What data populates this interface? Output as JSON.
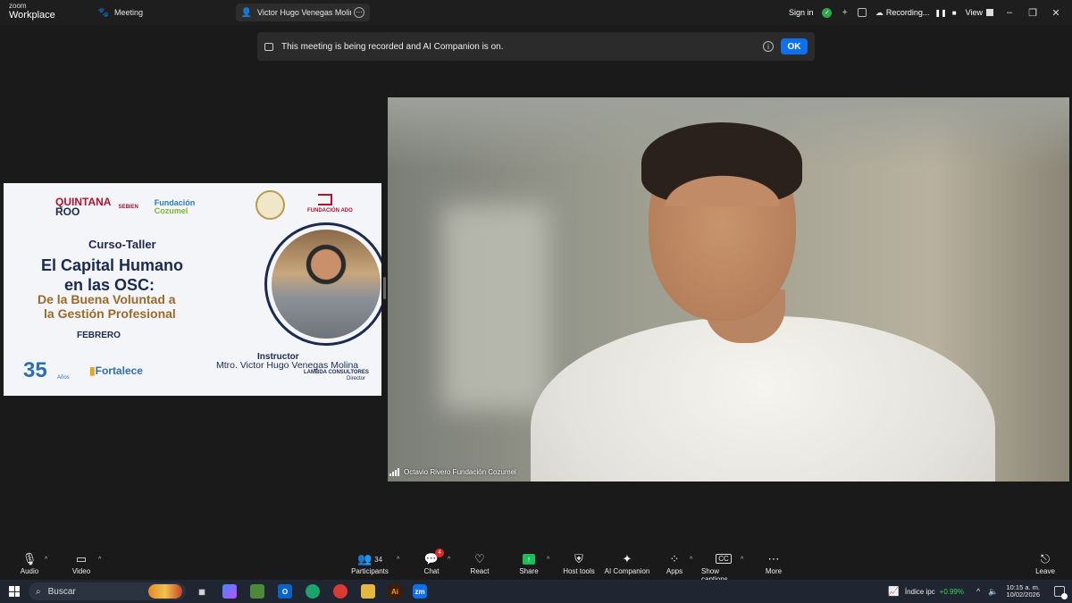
{
  "titlebar": {
    "brand_top": "zoom",
    "brand_bottom": "Workplace",
    "meeting_tab": "Meeting",
    "share_tab": "Victor Hugo Venegas Molina's scr",
    "share_tab_more": "⋯",
    "sign_in": "Sign in",
    "recording": "Recording...",
    "view": "View"
  },
  "banner": {
    "text": "This meeting is being recorded and AI Companion is on.",
    "ok_label": "OK"
  },
  "slide": {
    "logo_quintana": "QUINTANA",
    "logo_roo": "ROO",
    "logo_sebien": "SEBIEN",
    "logo_fundacion": "Fundación",
    "logo_cozumel": "Cozumel",
    "logo_ado": "FUNDACIÓN ADO",
    "course_type": "Curso-Taller",
    "title_line1": "El Capital Humano",
    "title_line2": "en las OSC:",
    "subtitle_line1": "De la Buena Voluntad a",
    "subtitle_line2": "la Gestión Profesional",
    "month": "FEBRERO",
    "instructor_label": "Instructor",
    "instructor_name": "Mtro. Victor Hugo Venegas Molina",
    "instructor_org": "LAMBDA CONSULTORES",
    "instructor_role": "Director",
    "anniversary": "35",
    "anniversary_years": "Años",
    "fortalece": "Fortalece"
  },
  "video": {
    "participant_name": "Octavio Rivero Fundación Cozumel"
  },
  "toolbar": {
    "audio": "Audio",
    "video": "Video",
    "participants": "Participants",
    "participants_count": "34",
    "chat": "Chat",
    "chat_badge": "4",
    "react": "React",
    "share": "Share",
    "host_tools": "Host tools",
    "ai_companion": "AI Companion",
    "apps": "Apps",
    "show_captions": "Show captions",
    "more": "More",
    "leave": "Leave"
  },
  "taskbar": {
    "search_placeholder": "Buscar",
    "stock_name": "Índice ipc",
    "stock_change": "+0.99%",
    "time": "10:15 a. m.",
    "date": "10/02/2026"
  },
  "colors": {
    "zoom_blue": "#0e71eb",
    "share_green": "#1dbd5a",
    "leave_red": "#e02828",
    "slide_navy": "#1b2a52",
    "slide_gold": "#9c6a28"
  }
}
